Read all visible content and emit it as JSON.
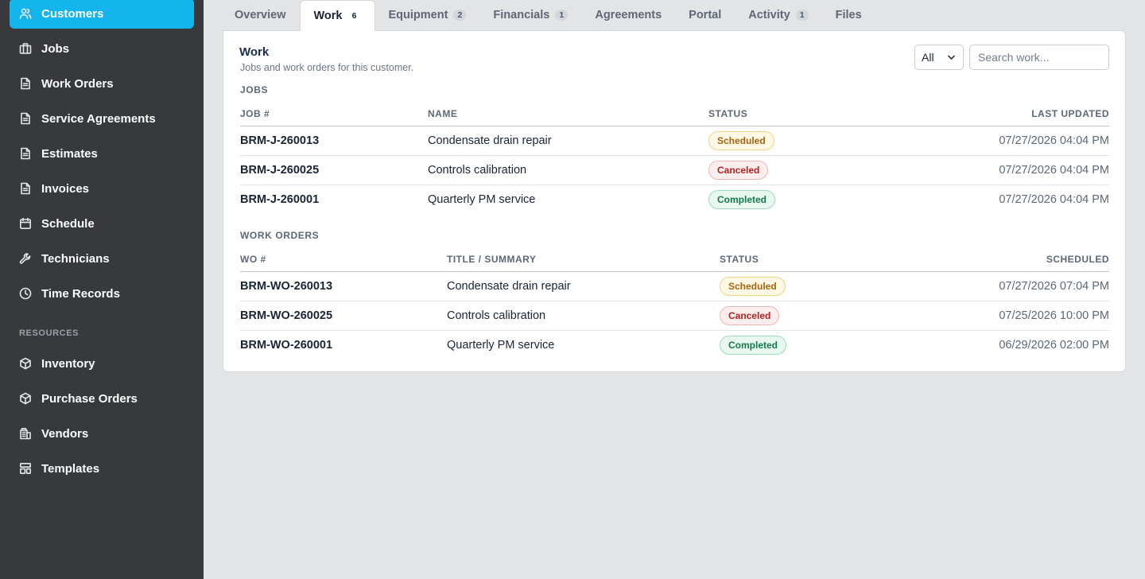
{
  "sidebar": {
    "items": [
      {
        "label": "Customers",
        "icon": "users-icon"
      },
      {
        "label": "Jobs",
        "icon": "briefcase-icon"
      },
      {
        "label": "Work Orders",
        "icon": "document-icon"
      },
      {
        "label": "Service Agreements",
        "icon": "document-icon"
      },
      {
        "label": "Estimates",
        "icon": "document-icon"
      },
      {
        "label": "Invoices",
        "icon": "document-icon"
      },
      {
        "label": "Schedule",
        "icon": "calendar-icon"
      },
      {
        "label": "Technicians",
        "icon": "wrench-icon"
      },
      {
        "label": "Time Records",
        "icon": "clock-icon"
      }
    ],
    "section_label": "RESOURCES",
    "resource_items": [
      {
        "label": "Inventory",
        "icon": "box-icon"
      },
      {
        "label": "Purchase Orders",
        "icon": "box-icon"
      },
      {
        "label": "Vendors",
        "icon": "building-icon"
      },
      {
        "label": "Templates",
        "icon": "template-icon"
      }
    ],
    "active": "Customers",
    "accent_color": "#13b5ec"
  },
  "tabs": [
    {
      "label": "Overview",
      "count": ""
    },
    {
      "label": "Work",
      "count": "6"
    },
    {
      "label": "Equipment",
      "count": "2"
    },
    {
      "label": "Financials",
      "count": "1"
    },
    {
      "label": "Agreements",
      "count": ""
    },
    {
      "label": "Portal",
      "count": ""
    },
    {
      "label": "Activity",
      "count": "1"
    },
    {
      "label": "Files",
      "count": ""
    }
  ],
  "active_tab": "Work",
  "panel": {
    "title": "Work",
    "subtitle": "Jobs and work orders for this customer.",
    "filter_value": "All",
    "search_placeholder": "Search work..."
  },
  "jobs": {
    "section_label": "JOBS",
    "headers": {
      "id": "JOB #",
      "name": "NAME",
      "status": "STATUS",
      "date": "LAST UPDATED"
    },
    "rows": [
      {
        "id": "BRM-J-260013",
        "name": "Condensate drain repair",
        "status": "Scheduled",
        "date": "07/27/2026 04:04 PM"
      },
      {
        "id": "BRM-J-260025",
        "name": "Controls calibration",
        "status": "Canceled",
        "date": "07/27/2026 04:04 PM"
      },
      {
        "id": "BRM-J-260001",
        "name": "Quarterly PM service",
        "status": "Completed",
        "date": "07/27/2026 04:04 PM"
      }
    ]
  },
  "work_orders": {
    "section_label": "WORK ORDERS",
    "headers": {
      "id": "WO #",
      "name": "TITLE / SUMMARY",
      "status": "STATUS",
      "date": "SCHEDULED"
    },
    "rows": [
      {
        "id": "BRM-WO-260013",
        "name": "Condensate drain repair",
        "status": "Scheduled",
        "date": "07/27/2026 07:04 PM"
      },
      {
        "id": "BRM-WO-260025",
        "name": "Controls calibration",
        "status": "Canceled",
        "date": "07/25/2026 10:00 PM"
      },
      {
        "id": "BRM-WO-260001",
        "name": "Quarterly PM service",
        "status": "Completed",
        "date": "06/29/2026 02:00 PM"
      }
    ]
  },
  "status_colors": {
    "Scheduled": "#a86410",
    "Canceled": "#b42323",
    "Completed": "#127a4a"
  }
}
